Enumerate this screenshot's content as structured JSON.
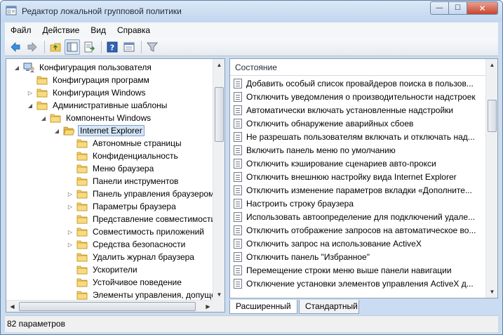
{
  "window": {
    "title": "Редактор локальной групповой политики",
    "minimize_glyph": "—",
    "maximize_glyph": "☐",
    "close_glyph": "✕"
  },
  "menu": [
    "Файл",
    "Действие",
    "Вид",
    "Справка"
  ],
  "toolbar": {
    "buttons": [
      "back-arrow-icon",
      "forward-arrow-icon",
      "up-folder-icon",
      "show-hide-tree-icon",
      "export-list-icon",
      "help-icon",
      "properties-icon",
      "filter-icon"
    ]
  },
  "tree": {
    "items": [
      {
        "label": "Конфигурация пользователя",
        "level": 0,
        "expander": "expanded",
        "icon": "computer-user-icon"
      },
      {
        "label": "Конфигурация программ",
        "level": 1,
        "expander": "none",
        "icon": "folder-icon"
      },
      {
        "label": "Конфигурация Windows",
        "level": 1,
        "expander": "collapsed",
        "icon": "folder-icon"
      },
      {
        "label": "Административные шаблоны",
        "level": 1,
        "expander": "expanded",
        "icon": "folder-icon"
      },
      {
        "label": "Компоненты Windows",
        "level": 2,
        "expander": "expanded",
        "icon": "folder-icon"
      },
      {
        "label": "Internet Explorer",
        "level": 3,
        "expander": "expanded",
        "icon": "folder-open-icon",
        "selected": true
      },
      {
        "label": "Автономные страницы",
        "level": 4,
        "expander": "none",
        "icon": "folder-icon"
      },
      {
        "label": "Конфиденциальность",
        "level": 4,
        "expander": "none",
        "icon": "folder-icon"
      },
      {
        "label": "Меню браузера",
        "level": 4,
        "expander": "none",
        "icon": "folder-icon"
      },
      {
        "label": "Панели инструментов",
        "level": 4,
        "expander": "none",
        "icon": "folder-icon"
      },
      {
        "label": "Панель управления браузером",
        "level": 4,
        "expander": "collapsed",
        "icon": "folder-icon"
      },
      {
        "label": "Параметры браузера",
        "level": 4,
        "expander": "collapsed",
        "icon": "folder-icon"
      },
      {
        "label": "Представление совместимости",
        "level": 4,
        "expander": "none",
        "icon": "folder-icon"
      },
      {
        "label": "Совместимость приложений",
        "level": 4,
        "expander": "collapsed",
        "icon": "folder-icon"
      },
      {
        "label": "Средства безопасности",
        "level": 4,
        "expander": "collapsed",
        "icon": "folder-icon"
      },
      {
        "label": "Удалить журнал браузера",
        "level": 4,
        "expander": "none",
        "icon": "folder-icon"
      },
      {
        "label": "Ускорители",
        "level": 4,
        "expander": "none",
        "icon": "folder-icon"
      },
      {
        "label": "Устойчивое поведение",
        "level": 4,
        "expander": "none",
        "icon": "folder-icon"
      },
      {
        "label": "Элементы управления, допущенны",
        "level": 4,
        "expander": "none",
        "icon": "folder-icon"
      }
    ]
  },
  "list": {
    "column_header": "Состояние",
    "rows": [
      "Добавить особый список провайдеров поиска в пользов...",
      "Отключить уведомления о производительности надстроек",
      "Автоматически включать установленные надстройки",
      "Отключить обнаружение аварийных сбоев",
      "Не разрешать пользователям включать и отключать над...",
      "Включить панель меню по умолчанию",
      "Отключить кэширование сценариев авто-прокси",
      "Отключить внешнюю настройку вида Internet Explorer",
      "Отключить изменение параметров вкладки «Дополните...",
      "Настроить строку браузера",
      "Использовать автоопределение для подключений удале...",
      "Отключить отображение запросов на автоматическое во...",
      "Отключить запрос на использование ActiveX",
      "Отключить панель \"Избранное\"",
      "Перемещение строки меню выше панели навигации",
      "Отключение установки элементов управления ActiveX д..."
    ]
  },
  "tabs": {
    "extended": "Расширенный",
    "standard": "Стандартный"
  },
  "status": {
    "text": "82 параметров"
  }
}
